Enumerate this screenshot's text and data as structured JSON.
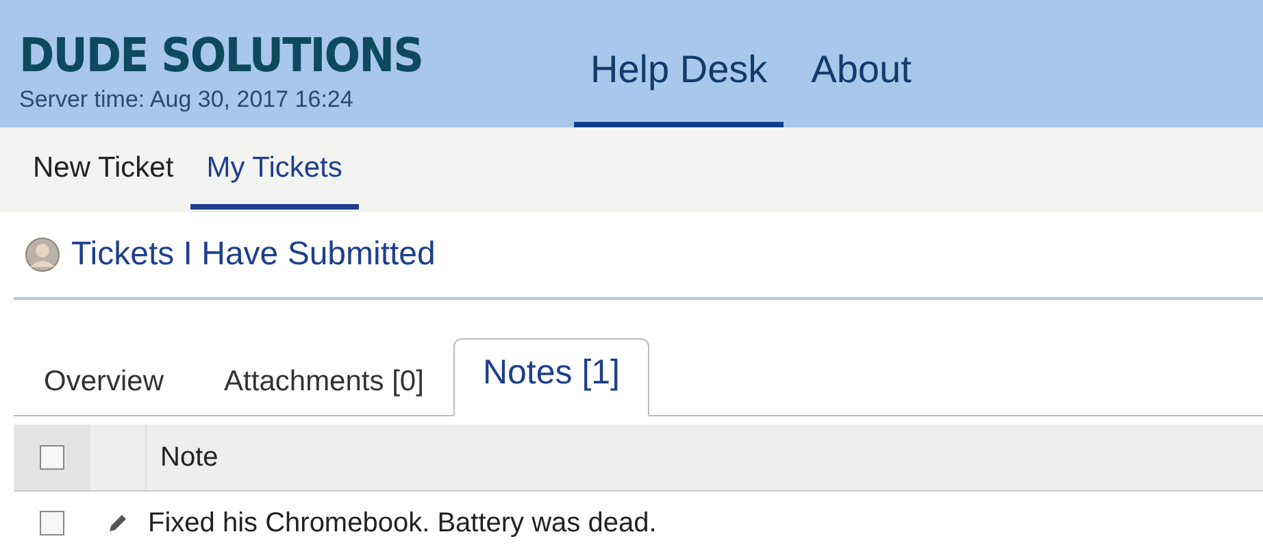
{
  "header": {
    "logo": "DUDE SOLUTIONS",
    "server_time": "Server time: Aug 30, 2017 16:24",
    "nav": [
      {
        "label": "Help Desk",
        "selected": true
      },
      {
        "label": "About",
        "selected": false
      }
    ]
  },
  "subnav": [
    {
      "label": "New Ticket",
      "selected": false
    },
    {
      "label": "My Tickets",
      "selected": true
    }
  ],
  "page_title": "Tickets I Have Submitted",
  "tabs": [
    {
      "label": "Overview",
      "selected": false
    },
    {
      "label": "Attachments [0]",
      "selected": false
    },
    {
      "label": "Notes [1]",
      "selected": true
    }
  ],
  "table": {
    "columns": [
      "Note"
    ],
    "header_checked": false,
    "rows": [
      {
        "checked": false,
        "note": "Fixed his Chromebook. Battery was dead."
      }
    ]
  }
}
